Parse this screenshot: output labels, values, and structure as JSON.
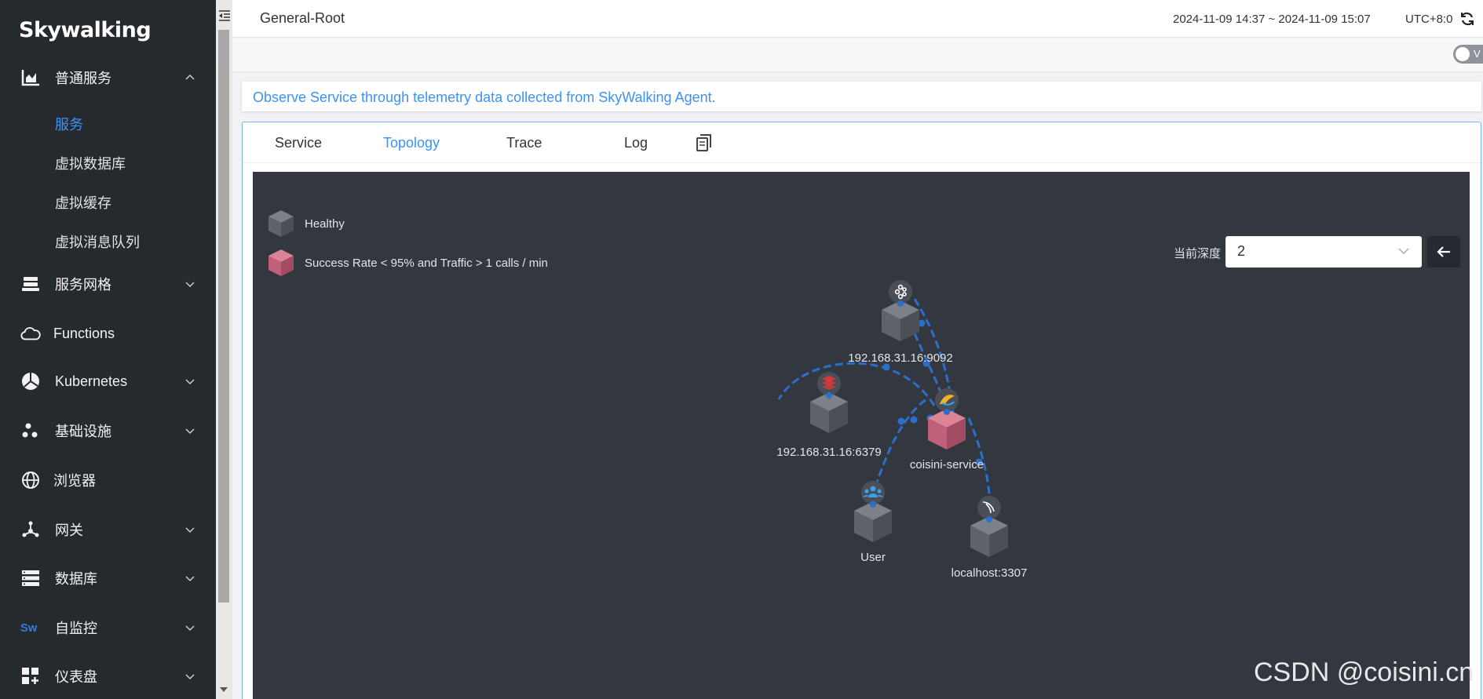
{
  "app": {
    "logo": "Skywalking"
  },
  "sidebar": {
    "groups": [
      {
        "label": "普通服务",
        "icon": "chart-icon",
        "expanded": true
      },
      {
        "label": "服务网格",
        "icon": "layers-icon"
      },
      {
        "label": "Functions",
        "icon": "cloud-icon"
      },
      {
        "label": "Kubernetes",
        "icon": "pie-icon"
      },
      {
        "label": "基础设施",
        "icon": "dots-icon"
      },
      {
        "label": "浏览器",
        "icon": "globe-icon"
      },
      {
        "label": "网关",
        "icon": "gateway-icon"
      },
      {
        "label": "数据库",
        "icon": "database-icon"
      },
      {
        "label": "自监控",
        "icon": "sw-icon"
      },
      {
        "label": "仪表盘",
        "icon": "dashboard-icon"
      }
    ],
    "sub_items": [
      {
        "label": "服务",
        "active": true
      },
      {
        "label": "虚拟数据库"
      },
      {
        "label": "虚拟缓存"
      },
      {
        "label": "虚拟消息队列"
      }
    ]
  },
  "header": {
    "title": "General-Root",
    "time_range": "2024-11-09 14:37 ~ 2024-11-09 15:07",
    "timezone": "UTC+8:0"
  },
  "toggle": {
    "label": "V"
  },
  "description": "Observe Service through telemetry data collected from SkyWalking Agent.",
  "tabs": [
    {
      "label": "Service"
    },
    {
      "label": "Topology",
      "active": true
    },
    {
      "label": "Trace"
    },
    {
      "label": "Log"
    }
  ],
  "topology": {
    "legend": [
      {
        "label": "Healthy",
        "color": "#5f646c"
      },
      {
        "label": "Success Rate < 95% and Traffic > 1 calls / min",
        "color": "#c06079"
      }
    ],
    "depth_label": "当前深度",
    "depth_value": "2",
    "nodes": [
      {
        "id": "kafka",
        "label": "192.168.31.16:9092",
        "icon": "kafka-icon",
        "status": "healthy"
      },
      {
        "id": "redis",
        "label": "192.168.31.16:6379",
        "icon": "redis-icon",
        "status": "healthy"
      },
      {
        "id": "service",
        "label": "coisini-service",
        "icon": "java-icon",
        "status": "alert"
      },
      {
        "id": "user",
        "label": "User",
        "icon": "users-icon",
        "status": "healthy"
      },
      {
        "id": "mysql",
        "label": "localhost:3307",
        "icon": "mysql-icon",
        "status": "healthy"
      }
    ],
    "edges": [
      {
        "from": "service",
        "to": "kafka"
      },
      {
        "from": "kafka",
        "to": "service"
      },
      {
        "from": "service",
        "to": "redis"
      },
      {
        "from": "user",
        "to": "service"
      },
      {
        "from": "service",
        "to": "mysql"
      }
    ]
  },
  "watermark": "CSDN @coisini.cn"
}
